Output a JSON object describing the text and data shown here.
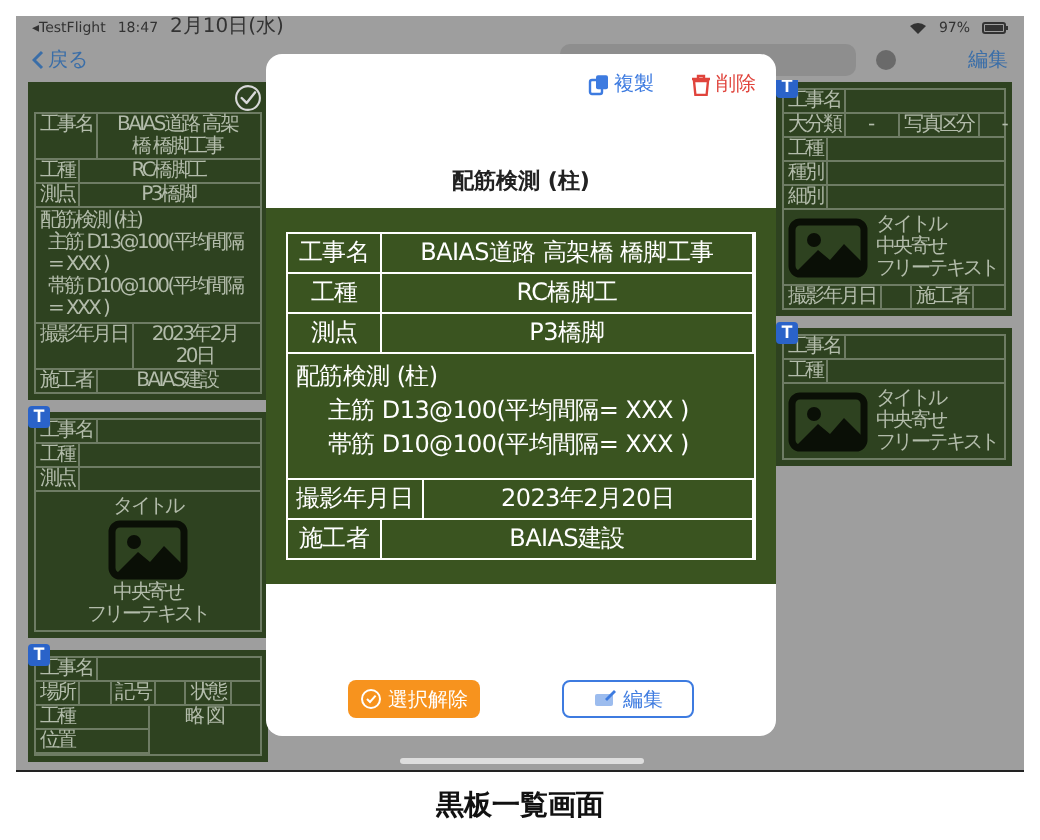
{
  "status_bar": {
    "app": "◂TestFlight",
    "time": "18:47",
    "date": "2月10日(水)",
    "battery": "97%"
  },
  "nav": {
    "back": "戻る",
    "edit": "編集"
  },
  "left_boards": [
    {
      "selected": true,
      "parts": [
        {
          "kind": "row",
          "cells": [
            {
              "kind": "label",
              "text": "工事名"
            },
            {
              "kind": "value",
              "text": "BAIAS道路 高架橋 橋脚工事"
            }
          ]
        },
        {
          "kind": "row",
          "cells": [
            {
              "kind": "label",
              "text": "工種"
            },
            {
              "kind": "value",
              "text": "RC橋脚工"
            }
          ]
        },
        {
          "kind": "row",
          "cells": [
            {
              "kind": "label",
              "text": "測点"
            },
            {
              "kind": "value",
              "text": "P3橋脚"
            }
          ]
        },
        {
          "kind": "lines",
          "heading": "配筋検測 (柱)",
          "items": [
            "主筋 D13@100(平均間隔= XXX )",
            "帯筋 D10@100(平均間隔= XXX )"
          ]
        },
        {
          "kind": "row",
          "cells": [
            {
              "kind": "label",
              "text": "撮影年月日"
            },
            {
              "kind": "value",
              "text": "2023年2月20日"
            }
          ]
        },
        {
          "kind": "row",
          "cells": [
            {
              "kind": "label",
              "text": "施工者"
            },
            {
              "kind": "value",
              "text": "BAIAS建設"
            }
          ]
        }
      ]
    },
    {
      "selected": false,
      "badge": "T",
      "parts": [
        {
          "kind": "row",
          "cells": [
            {
              "kind": "label",
              "text": "工事名"
            },
            {
              "kind": "blank"
            }
          ]
        },
        {
          "kind": "row",
          "cells": [
            {
              "kind": "label",
              "text": "工種"
            },
            {
              "kind": "blank"
            }
          ]
        },
        {
          "kind": "row",
          "cells": [
            {
              "kind": "label",
              "text": "測点"
            },
            {
              "kind": "blank"
            }
          ]
        },
        {
          "kind": "photo-stack",
          "title": "タイトル",
          "notes": [
            "中央寄せ",
            "フリーテキスト"
          ]
        }
      ]
    },
    {
      "selected": false,
      "badge": "T",
      "parts": [
        {
          "kind": "row",
          "cells": [
            {
              "kind": "label",
              "text": "工事名"
            },
            {
              "kind": "blank"
            }
          ]
        },
        {
          "kind": "row",
          "cells": [
            {
              "kind": "label",
              "text": "場所"
            },
            {
              "kind": "blank"
            },
            {
              "kind": "label",
              "text": "記号"
            },
            {
              "kind": "blank"
            },
            {
              "kind": "label",
              "text": "状態"
            },
            {
              "kind": "blank"
            }
          ]
        },
        {
          "kind": "split",
          "rows": [
            [
              {
                "kind": "label",
                "text": "工種"
              }
            ],
            [
              {
                "kind": "label",
                "text": "位置"
              }
            ]
          ],
          "side_title": "略 図"
        }
      ]
    }
  ],
  "right_boards": [
    {
      "selected": false,
      "badge": "T",
      "parts": [
        {
          "kind": "row",
          "cells": [
            {
              "kind": "label",
              "text": "工事名"
            },
            {
              "kind": "blank"
            }
          ]
        },
        {
          "kind": "row",
          "cells": [
            {
              "kind": "label",
              "text": "大分類"
            },
            {
              "kind": "value",
              "text": "-"
            },
            {
              "kind": "label",
              "text": "写真区分"
            },
            {
              "kind": "value",
              "text": "-"
            }
          ]
        },
        {
          "kind": "row",
          "cells": [
            {
              "kind": "label",
              "text": "工種"
            },
            {
              "kind": "blank"
            }
          ]
        },
        {
          "kind": "row",
          "cells": [
            {
              "kind": "label",
              "text": "種別"
            },
            {
              "kind": "blank"
            }
          ]
        },
        {
          "kind": "row",
          "cells": [
            {
              "kind": "label",
              "text": "細別"
            },
            {
              "kind": "blank"
            }
          ]
        },
        {
          "kind": "photo-side",
          "title": "タイトル",
          "notes": [
            "中央寄せ",
            "フリーテキスト"
          ]
        },
        {
          "kind": "row",
          "cells": [
            {
              "kind": "label",
              "text": "撮影年月日"
            },
            {
              "kind": "blank"
            },
            {
              "kind": "label",
              "text": "施工者"
            },
            {
              "kind": "blank"
            }
          ]
        }
      ]
    },
    {
      "selected": false,
      "badge": "T",
      "parts": [
        {
          "kind": "row",
          "cells": [
            {
              "kind": "label",
              "text": "工事名"
            },
            {
              "kind": "blank"
            }
          ]
        },
        {
          "kind": "row",
          "cells": [
            {
              "kind": "label",
              "text": "工種"
            },
            {
              "kind": "blank"
            }
          ]
        },
        {
          "kind": "photo-side",
          "title": "タイトル",
          "notes": [
            "中央寄せ",
            "フリーテキスト"
          ]
        }
      ]
    }
  ],
  "modal": {
    "actions": [
      {
        "kind": "copy",
        "label": "複製"
      },
      {
        "kind": "delete",
        "label": "削除"
      }
    ],
    "title": "配筋検測 (柱)",
    "board": {
      "parts": [
        {
          "kind": "row",
          "cells": [
            {
              "kind": "label",
              "text": "工事名"
            },
            {
              "kind": "value",
              "text": "BAIAS道路 高架橋 橋脚工事"
            }
          ]
        },
        {
          "kind": "row",
          "cells": [
            {
              "kind": "label",
              "text": "工種"
            },
            {
              "kind": "value",
              "text": "RC橋脚工"
            }
          ]
        },
        {
          "kind": "row",
          "cells": [
            {
              "kind": "label",
              "text": "測点"
            },
            {
              "kind": "value",
              "text": "P3橋脚"
            }
          ]
        },
        {
          "kind": "lines",
          "heading": "配筋検測 (柱)",
          "items": [
            "主筋 D13@100(平均間隔= XXX )",
            "帯筋 D10@100(平均間隔= XXX )"
          ]
        },
        {
          "kind": "row",
          "cells": [
            {
              "kind": "label",
              "text": "撮影年月日"
            },
            {
              "kind": "value",
              "text": "2023年2月20日"
            }
          ]
        },
        {
          "kind": "row",
          "cells": [
            {
              "kind": "label",
              "text": "施工者"
            },
            {
              "kind": "value",
              "text": "BAIAS建設"
            }
          ]
        }
      ]
    },
    "buttons": [
      {
        "kind": "deselect",
        "label": "選択解除"
      },
      {
        "kind": "edit",
        "label": "編集"
      }
    ]
  },
  "caption": "黒板一覧画面"
}
